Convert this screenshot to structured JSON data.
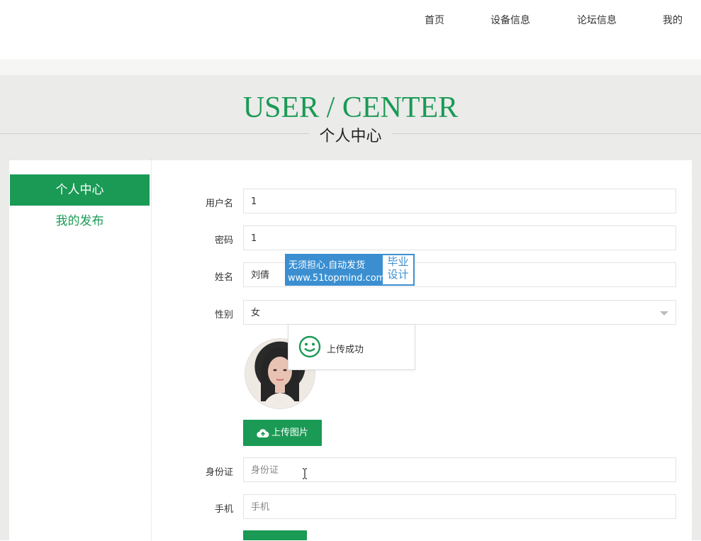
{
  "nav": {
    "home": "首页",
    "devices": "设备信息",
    "forum": "论坛信息",
    "mine": "我的"
  },
  "banner": {
    "title": "USER / CENTER",
    "subtitle": "个人中心"
  },
  "sidebar": {
    "items": [
      {
        "label": "个人中心"
      },
      {
        "label": "我的发布"
      }
    ]
  },
  "form": {
    "username_label": "用户名",
    "username_value": "1",
    "password_label": "密码",
    "password_value": "1",
    "name_label": "姓名",
    "name_value": "刘倩",
    "gender_label": "性别",
    "gender_value": "女",
    "upload_label": "上传图片",
    "idcard_label": "身份证",
    "idcard_placeholder": "身份证",
    "phone_label": "手机",
    "phone_placeholder": "手机"
  },
  "toast": {
    "text": "上传成功"
  },
  "watermark": {
    "line1": "无须担心.自动发货",
    "line2": "www.51topmind.com",
    "badge_line1": "毕业",
    "badge_line2": "设计"
  },
  "colors": {
    "accent": "#1a9a55",
    "watermark": "#3b8fd1"
  },
  "icons": {
    "upload": "cloud-upload-icon",
    "toast": "smile-icon",
    "select": "chevron-down-icon",
    "cursor": "text-cursor-icon"
  }
}
